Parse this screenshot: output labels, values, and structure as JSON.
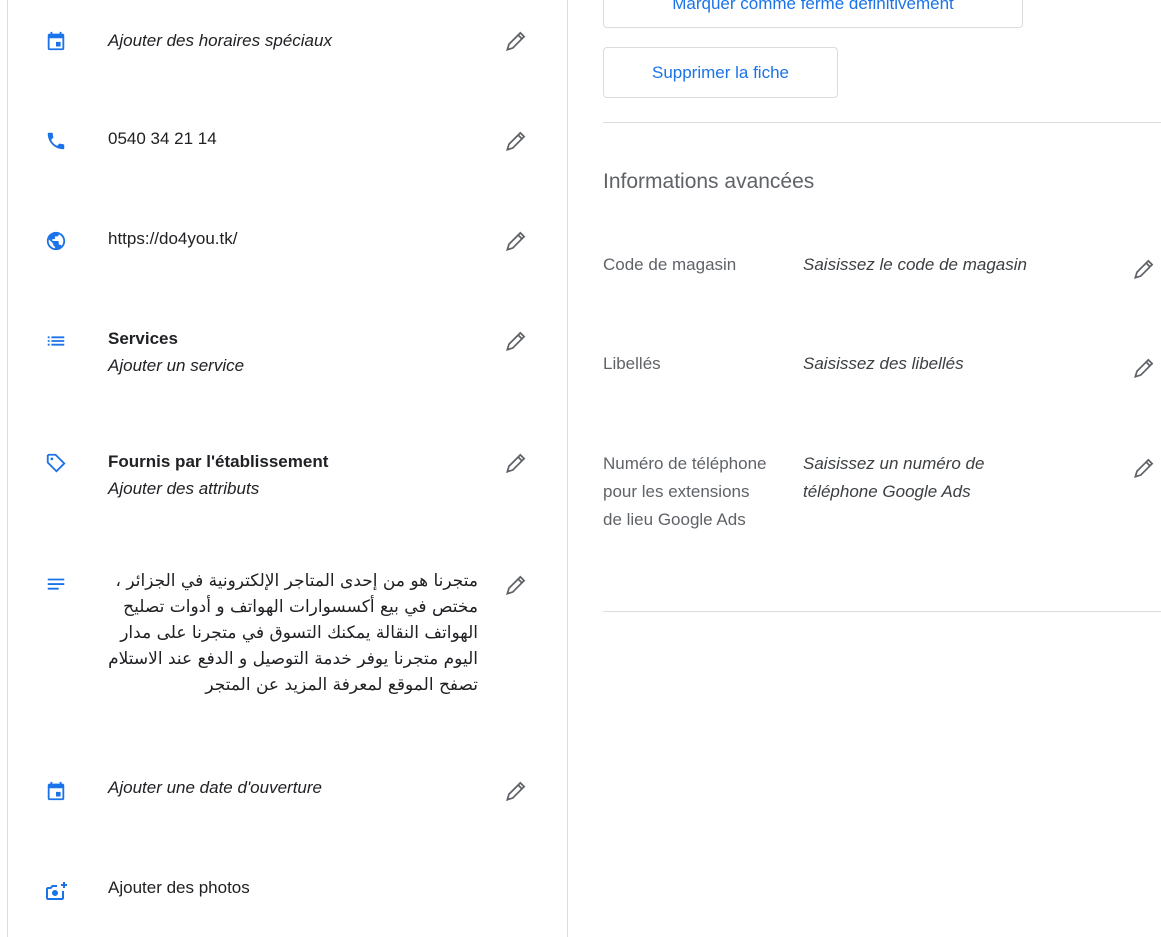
{
  "colors": {
    "icon_blue": "#1a73e8",
    "pencil": "#5f6368",
    "divider": "#dadce0"
  },
  "left": {
    "special_hours": {
      "icon": "calendar-icon",
      "text": "Ajouter des horaires spéciaux"
    },
    "phone": {
      "icon": "phone-icon",
      "text": "0540 34 21 14"
    },
    "website": {
      "icon": "globe-icon",
      "text": "https://do4you.tk/"
    },
    "services": {
      "icon": "list-icon",
      "title": "Services",
      "subtitle": "Ajouter un service"
    },
    "attributes": {
      "icon": "tag-icon",
      "title": "Fournis par l'établissement",
      "subtitle": "Ajouter des attributs"
    },
    "description": {
      "icon": "notes-icon",
      "text": "متجرنا هو من إحدى المتاجر الإلكترونية في الجزائر ، مختص في بيع أكسسوارات الهواتف و أدوات تصليح الهواتف النقالة يمكنك التسوق في متجرنا على مدار اليوم متجرنا يوفر خدمة التوصيل و الدفع عند الاستلام تصفح الموقع لمعرفة المزيد عن المتجر"
    },
    "opening_date": {
      "icon": "calendar-icon",
      "text": "Ajouter une date d'ouverture"
    },
    "photos": {
      "icon": "add-photo-icon",
      "text": "Ajouter des photos"
    }
  },
  "right": {
    "mark_closed_button": "Marquer comme fermé définitivement",
    "delete_button": "Supprimer la fiche",
    "advanced_title": "Informations avancées",
    "store_code": {
      "label": "Code de magasin",
      "value": "Saisissez le code de magasin"
    },
    "labels": {
      "label": "Libellés",
      "value": "Saisissez des libellés"
    },
    "ads_phone": {
      "label": "Numéro de téléphone pour les extensions de lieu Google Ads",
      "value": "Saisissez un numéro de téléphone Google Ads"
    }
  }
}
